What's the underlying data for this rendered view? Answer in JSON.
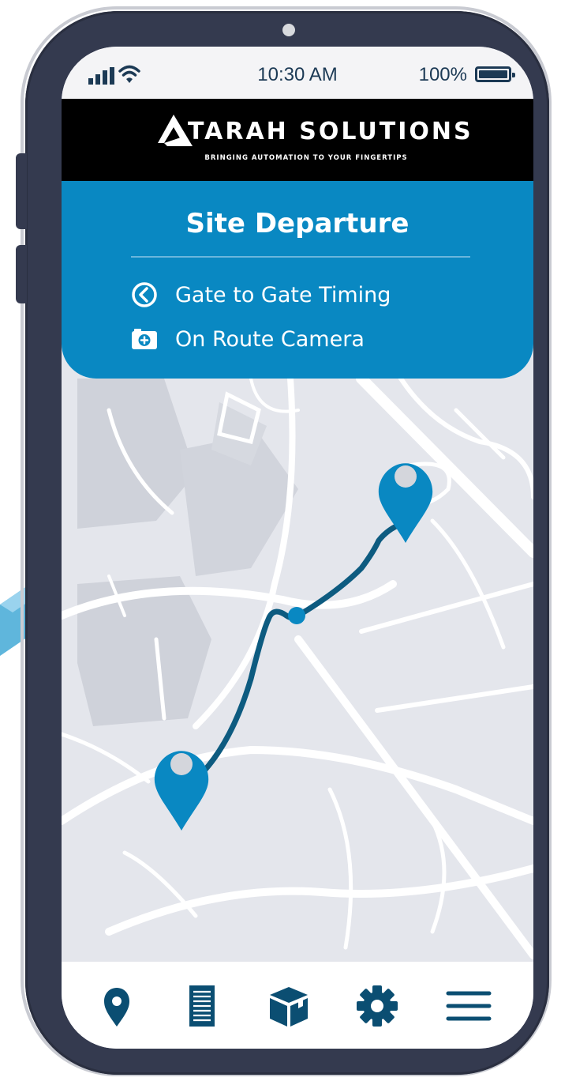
{
  "status_bar": {
    "time": "10:30 AM",
    "battery": "100%",
    "battery_level": 1.0
  },
  "brand": {
    "name": "TARAH SOLUTIONS",
    "tagline": "BRINGING AUTOMATION TO YOUR FINGERTIPS",
    "logo_letter": "A"
  },
  "panel": {
    "title": "Site Departure",
    "features": [
      {
        "icon": "clock-icon",
        "label": "Gate to Gate Timing"
      },
      {
        "icon": "camera-plus-icon",
        "label": "On Route Camera"
      }
    ]
  },
  "map": {
    "markers": [
      "origin-pin-icon",
      "destination-pin-icon",
      "waypoint-dot"
    ]
  },
  "bottom_nav": {
    "items": [
      "location-pin-icon",
      "document-icon",
      "package-icon",
      "gear-icon",
      "menu-icon"
    ]
  },
  "colors": {
    "accent": "#0988c2",
    "route": "#0d5b80",
    "phone_body": "#343a4f",
    "nav_icon": "#0b4e72",
    "map_background": "#e4e6ec"
  }
}
